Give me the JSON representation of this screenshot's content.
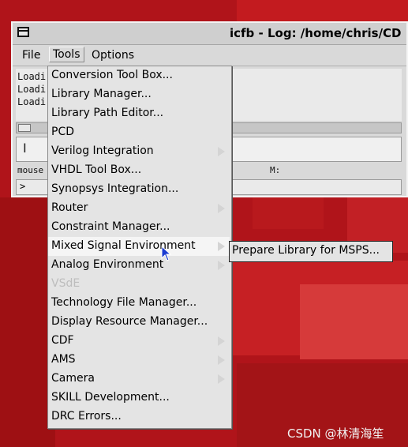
{
  "window": {
    "title": "icfb - Log: /home/chris/CD",
    "menu": [
      "File",
      "Tools",
      "Options"
    ],
    "log_lines": [
      "Loadi",
      "Loadi",
      "Loadi"
    ],
    "mouse_label": "mouse",
    "m_label": "M:",
    "prompt": ">"
  },
  "tools_menu": {
    "items": [
      {
        "label": "Conversion Tool Box...",
        "submenu": false,
        "disabled": false
      },
      {
        "label": "Library Manager...",
        "submenu": false,
        "disabled": false
      },
      {
        "label": "Library Path Editor...",
        "submenu": false,
        "disabled": false
      },
      {
        "label": "PCD",
        "submenu": false,
        "disabled": false
      },
      {
        "label": "Verilog Integration",
        "submenu": true,
        "disabled": false
      },
      {
        "label": "VHDL Tool Box...",
        "submenu": false,
        "disabled": false
      },
      {
        "label": "Synopsys Integration...",
        "submenu": false,
        "disabled": false
      },
      {
        "label": "Router",
        "submenu": true,
        "disabled": false
      },
      {
        "label": "Constraint Manager...",
        "submenu": false,
        "disabled": false
      },
      {
        "label": "Mixed Signal Environment",
        "submenu": true,
        "disabled": false
      },
      {
        "label": "Analog Environment",
        "submenu": true,
        "disabled": false
      },
      {
        "label": "VSdE",
        "submenu": false,
        "disabled": true
      },
      {
        "label": "Technology File Manager...",
        "submenu": false,
        "disabled": false
      },
      {
        "label": "Display Resource Manager...",
        "submenu": false,
        "disabled": false
      },
      {
        "label": "CDF",
        "submenu": true,
        "disabled": false
      },
      {
        "label": "AMS",
        "submenu": true,
        "disabled": false
      },
      {
        "label": "Camera",
        "submenu": true,
        "disabled": false
      },
      {
        "label": "SKILL Development...",
        "submenu": false,
        "disabled": false
      },
      {
        "label": "DRC Errors...",
        "submenu": false,
        "disabled": false
      }
    ]
  },
  "submenu": {
    "label": "Prepare Library for MSPS..."
  },
  "watermark": "CSDN @林清海笙"
}
